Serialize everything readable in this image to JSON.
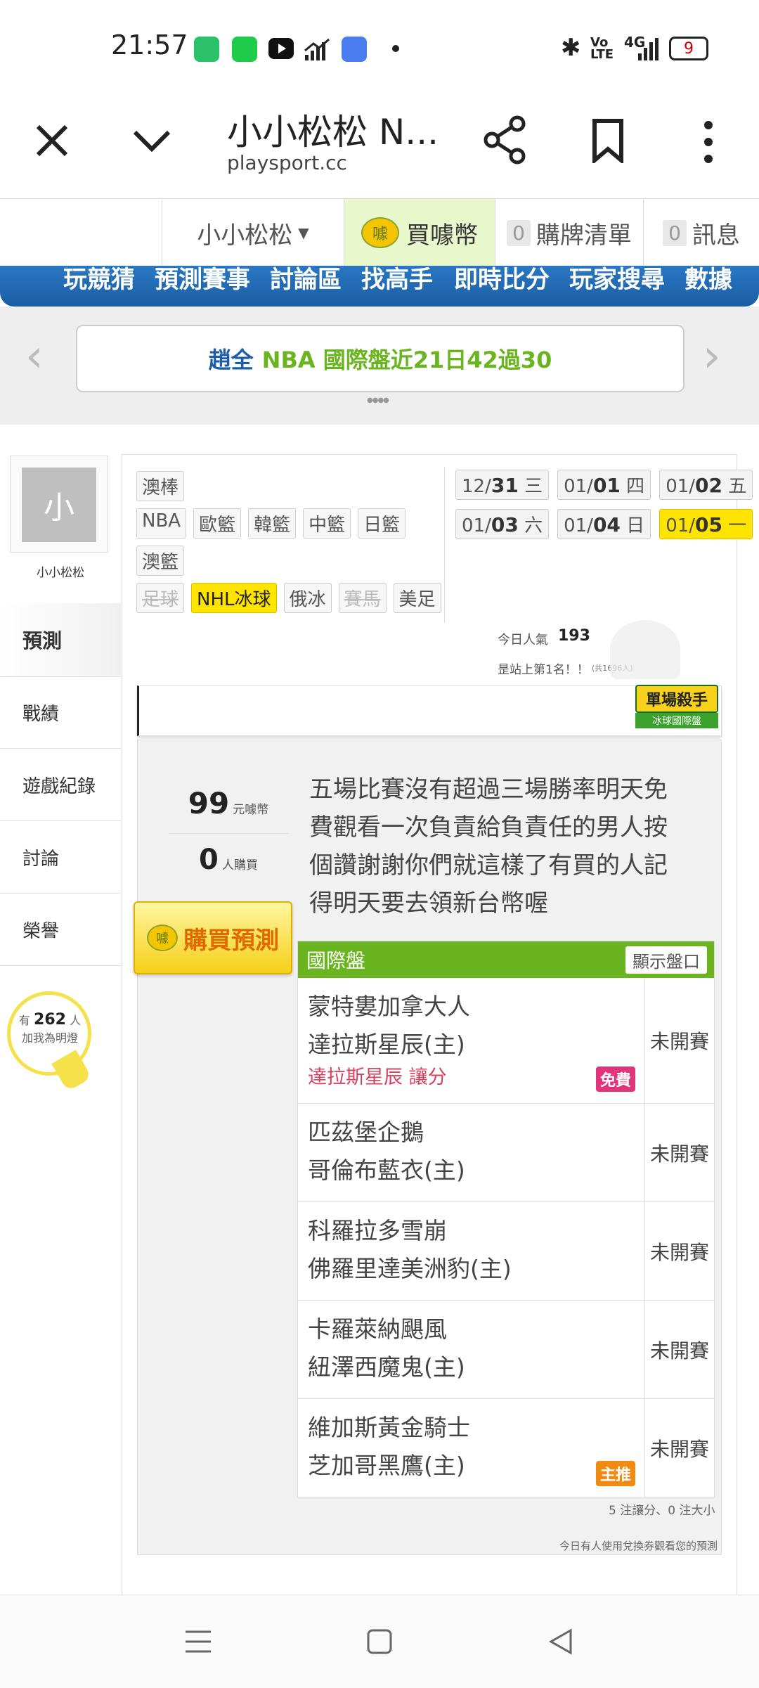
{
  "status_bar": {
    "time": "21:57",
    "network": "4G",
    "battery": "9",
    "icons": [
      "battery-app-icon",
      "app-icon",
      "youtube-icon",
      "signal-bars-icon",
      "app-square-icon",
      "dot-icon",
      "bluetooth-icon",
      "volte-icon"
    ]
  },
  "browser": {
    "title": "小小松松 N...",
    "url": "playsport.cc"
  },
  "site_header": {
    "user": "小小松松",
    "buy_coin": "買噱幣",
    "cart_count": "0",
    "cart_label": "購牌清單",
    "msg_count": "0",
    "msg_label": "訊息",
    "coin_icon_text": "噱"
  },
  "nav": [
    "玩競猜",
    "預測賽事",
    "討論區",
    "找高手",
    "即時比分",
    "玩家搜尋",
    "數據"
  ],
  "banner": {
    "name": "趙全",
    "text": "NBA 國際盤近21日42過30",
    "dots": "●●●●"
  },
  "profile": {
    "avatar_char": "小",
    "name": "小小松松"
  },
  "side_menu": [
    "預測",
    "戰績",
    "遊戲紀錄",
    "討論",
    "榮譽"
  ],
  "lamp": {
    "prefix": "有",
    "count": "262",
    "suffix": "人",
    "line2": "加我為明燈"
  },
  "sport_tags": {
    "row1": [
      "澳棒"
    ],
    "row2": [
      "NBA",
      "歐籃",
      "韓籃",
      "中籃",
      "日籃"
    ],
    "row3": [
      "澳籃"
    ],
    "row4": [
      "足球",
      "NHL冰球",
      "俄冰",
      "賽馬",
      "美足"
    ]
  },
  "dates": [
    {
      "md": "12/",
      "d": "31",
      "w": "三"
    },
    {
      "md": "01/",
      "d": "01",
      "w": "四"
    },
    {
      "md": "01/",
      "d": "02",
      "w": "五"
    },
    {
      "md": "01/",
      "d": "03",
      "w": "六"
    },
    {
      "md": "01/",
      "d": "04",
      "w": "日"
    },
    {
      "md": "01/",
      "d": "05",
      "w": "一"
    }
  ],
  "popularity": {
    "label": "今日人氣",
    "value": "193",
    "rank": "昰站上第1名！！",
    "total": "(共1696人)"
  },
  "killer_badge": {
    "line1": "單場殺手",
    "line2": "冰球國際盤"
  },
  "prediction": {
    "price": "99",
    "price_unit": "元噱幣",
    "buyers": "0",
    "buyers_unit": "人購買",
    "buy_button": "購買預測",
    "description": "五場比賽沒有超過三場勝率明天免費觀看一次負責給負責任的男人按個讚謝謝你們就這樣了有買的人記得明天要去領新台幣喔"
  },
  "games_header": {
    "title": "國際盤",
    "button": "顯示盤口"
  },
  "games": [
    {
      "away": "蒙特婁加拿大人",
      "home": "達拉斯星辰(主)",
      "pick": "達拉斯星辰 讓分",
      "badge": "免費",
      "status": "未開賽"
    },
    {
      "away": "匹茲堡企鵝",
      "home": "哥倫布藍衣(主)",
      "pick": "",
      "badge": "",
      "status": "未開賽"
    },
    {
      "away": "科羅拉多雪崩",
      "home": "佛羅里達美洲豹(主)",
      "pick": "",
      "badge": "",
      "status": "未開賽"
    },
    {
      "away": "卡羅萊納颶風",
      "home": "紐澤西魔鬼(主)",
      "pick": "",
      "badge": "",
      "status": "未開賽"
    },
    {
      "away": "維加斯黃金騎士",
      "home": "芝加哥黑鷹(主)",
      "pick": "",
      "badge": "主推",
      "status": "未開賽"
    }
  ],
  "summary": "5 注讓分、0 注大小",
  "footer_note": "今日有人使用兌換券觀看您的預測",
  "colors": {
    "nav_blue": "#1f6bb5",
    "green": "#6ab51f",
    "yellow": "#ffe400",
    "red_pick": "#d6405e",
    "pink_badge": "#e0357a",
    "orange_badge": "#f08a12"
  }
}
